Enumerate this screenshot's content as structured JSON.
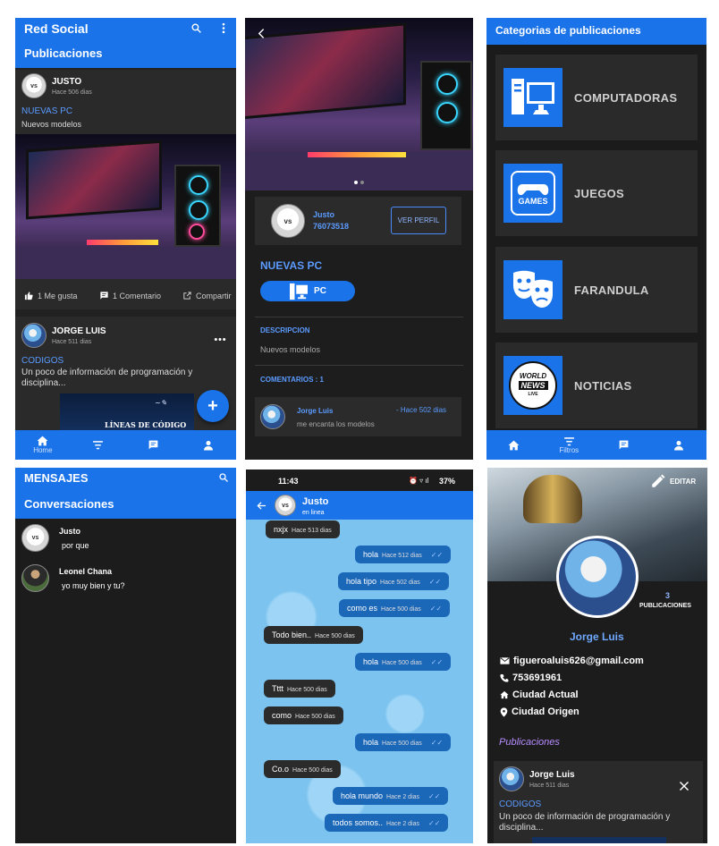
{
  "s1": {
    "app_title": "Red Social",
    "section": "Publicaciones",
    "post1": {
      "author": "JUSTO",
      "avatar_text": "vs",
      "time": "Hace 506 dias",
      "category": "NUEVAS PC",
      "description": "Nuevos modelos"
    },
    "actions": {
      "like": "1 Me gusta",
      "comment": "1 Comentario",
      "share": "Compartir"
    },
    "post2": {
      "author": "JORGE LUIS",
      "time": "Hace 511 dias",
      "category": "CODIGOS",
      "description": "Un poco de información de programación y disciplina...",
      "image_caption": "LÍNEAS DE CÓDIGO",
      "fab": "+"
    },
    "nav": {
      "home": "Home"
    }
  },
  "s2": {
    "user": {
      "name": "Justo",
      "phone": "76073518",
      "avatar_text": "vs"
    },
    "profile_button": "VER PERFIL",
    "title": "NUEVAS PC",
    "category_chip": "PC",
    "desc_heading": "DESCRIPCION",
    "description": "Nuevos modelos",
    "comments_heading": "COMENTARIOS : 1",
    "comment": {
      "author": "Jorge Luis",
      "time": "- Hace 502 dias",
      "text": "me encanta los modelos"
    }
  },
  "s3": {
    "title": "Categorias de publicaciones",
    "categories": [
      {
        "label": "COMPUTADORAS",
        "icon": "computer-icon"
      },
      {
        "label": "JUEGOS",
        "icon": "games-icon",
        "icon_text": "GAMES"
      },
      {
        "label": "FARANDULA",
        "icon": "theater-masks-icon"
      },
      {
        "label": "NOTICIAS",
        "icon": "world-news-icon",
        "icon_text1": "WORLD",
        "icon_text2": "NEWS",
        "icon_text3": "LIVE"
      }
    ],
    "nav": {
      "filters": "Filtros"
    }
  },
  "s4": {
    "title": "MENSAJES",
    "section": "Conversaciones",
    "conversations": [
      {
        "name": "Justo",
        "last": "por que",
        "avatar_text": "vs"
      },
      {
        "name": "Leonel Chana",
        "last": "yo muy bien y tu?"
      }
    ]
  },
  "s5": {
    "status_time": "11:43",
    "battery": "37%",
    "contact": "Justo",
    "contact_status": "en linea",
    "avatar_text": "vs",
    "messages": [
      {
        "text": "nxjx",
        "time": "Hace 513 dias",
        "mine": false
      },
      {
        "text": "hola",
        "time": "Hace 512 dias",
        "mine": true
      },
      {
        "text": "hola tipo",
        "time": "Hace 502 dias",
        "mine": true
      },
      {
        "text": "como es",
        "time": "Hace 500 dias",
        "mine": true
      },
      {
        "text": "Todo bien..",
        "time": "Hace 500 dias",
        "mine": false
      },
      {
        "text": "hola",
        "time": "Hace 500 dias",
        "mine": true
      },
      {
        "text": "Tttt",
        "time": "Hace 500 dias",
        "mine": false
      },
      {
        "text": "como",
        "time": "Hace 500 dias",
        "mine": false
      },
      {
        "text": "hola",
        "time": "Hace 500 dias",
        "mine": true
      },
      {
        "text": "Co.o",
        "time": "Hace 500 dias",
        "mine": false
      },
      {
        "text": "hola mundo",
        "time": "Hace 2 dias",
        "mine": true
      },
      {
        "text": "todos somos..",
        "time": "Hace 2 dias",
        "mine": true
      }
    ]
  },
  "s6": {
    "edit": "EDITAR",
    "posts_count": "3",
    "posts_label": "PUBLICACIONES",
    "name": "Jorge Luis",
    "email": "figueroaluis626@gmail.com",
    "phone": "753691961",
    "current_city": "Ciudad Actual",
    "origin_city": "Ciudad Origen",
    "section": "Publicaciones",
    "post": {
      "author": "Jorge Luis",
      "time": "Hace 511 dias",
      "category": "CODIGOS",
      "description": "Un poco de información de programación y disciplina..."
    }
  }
}
